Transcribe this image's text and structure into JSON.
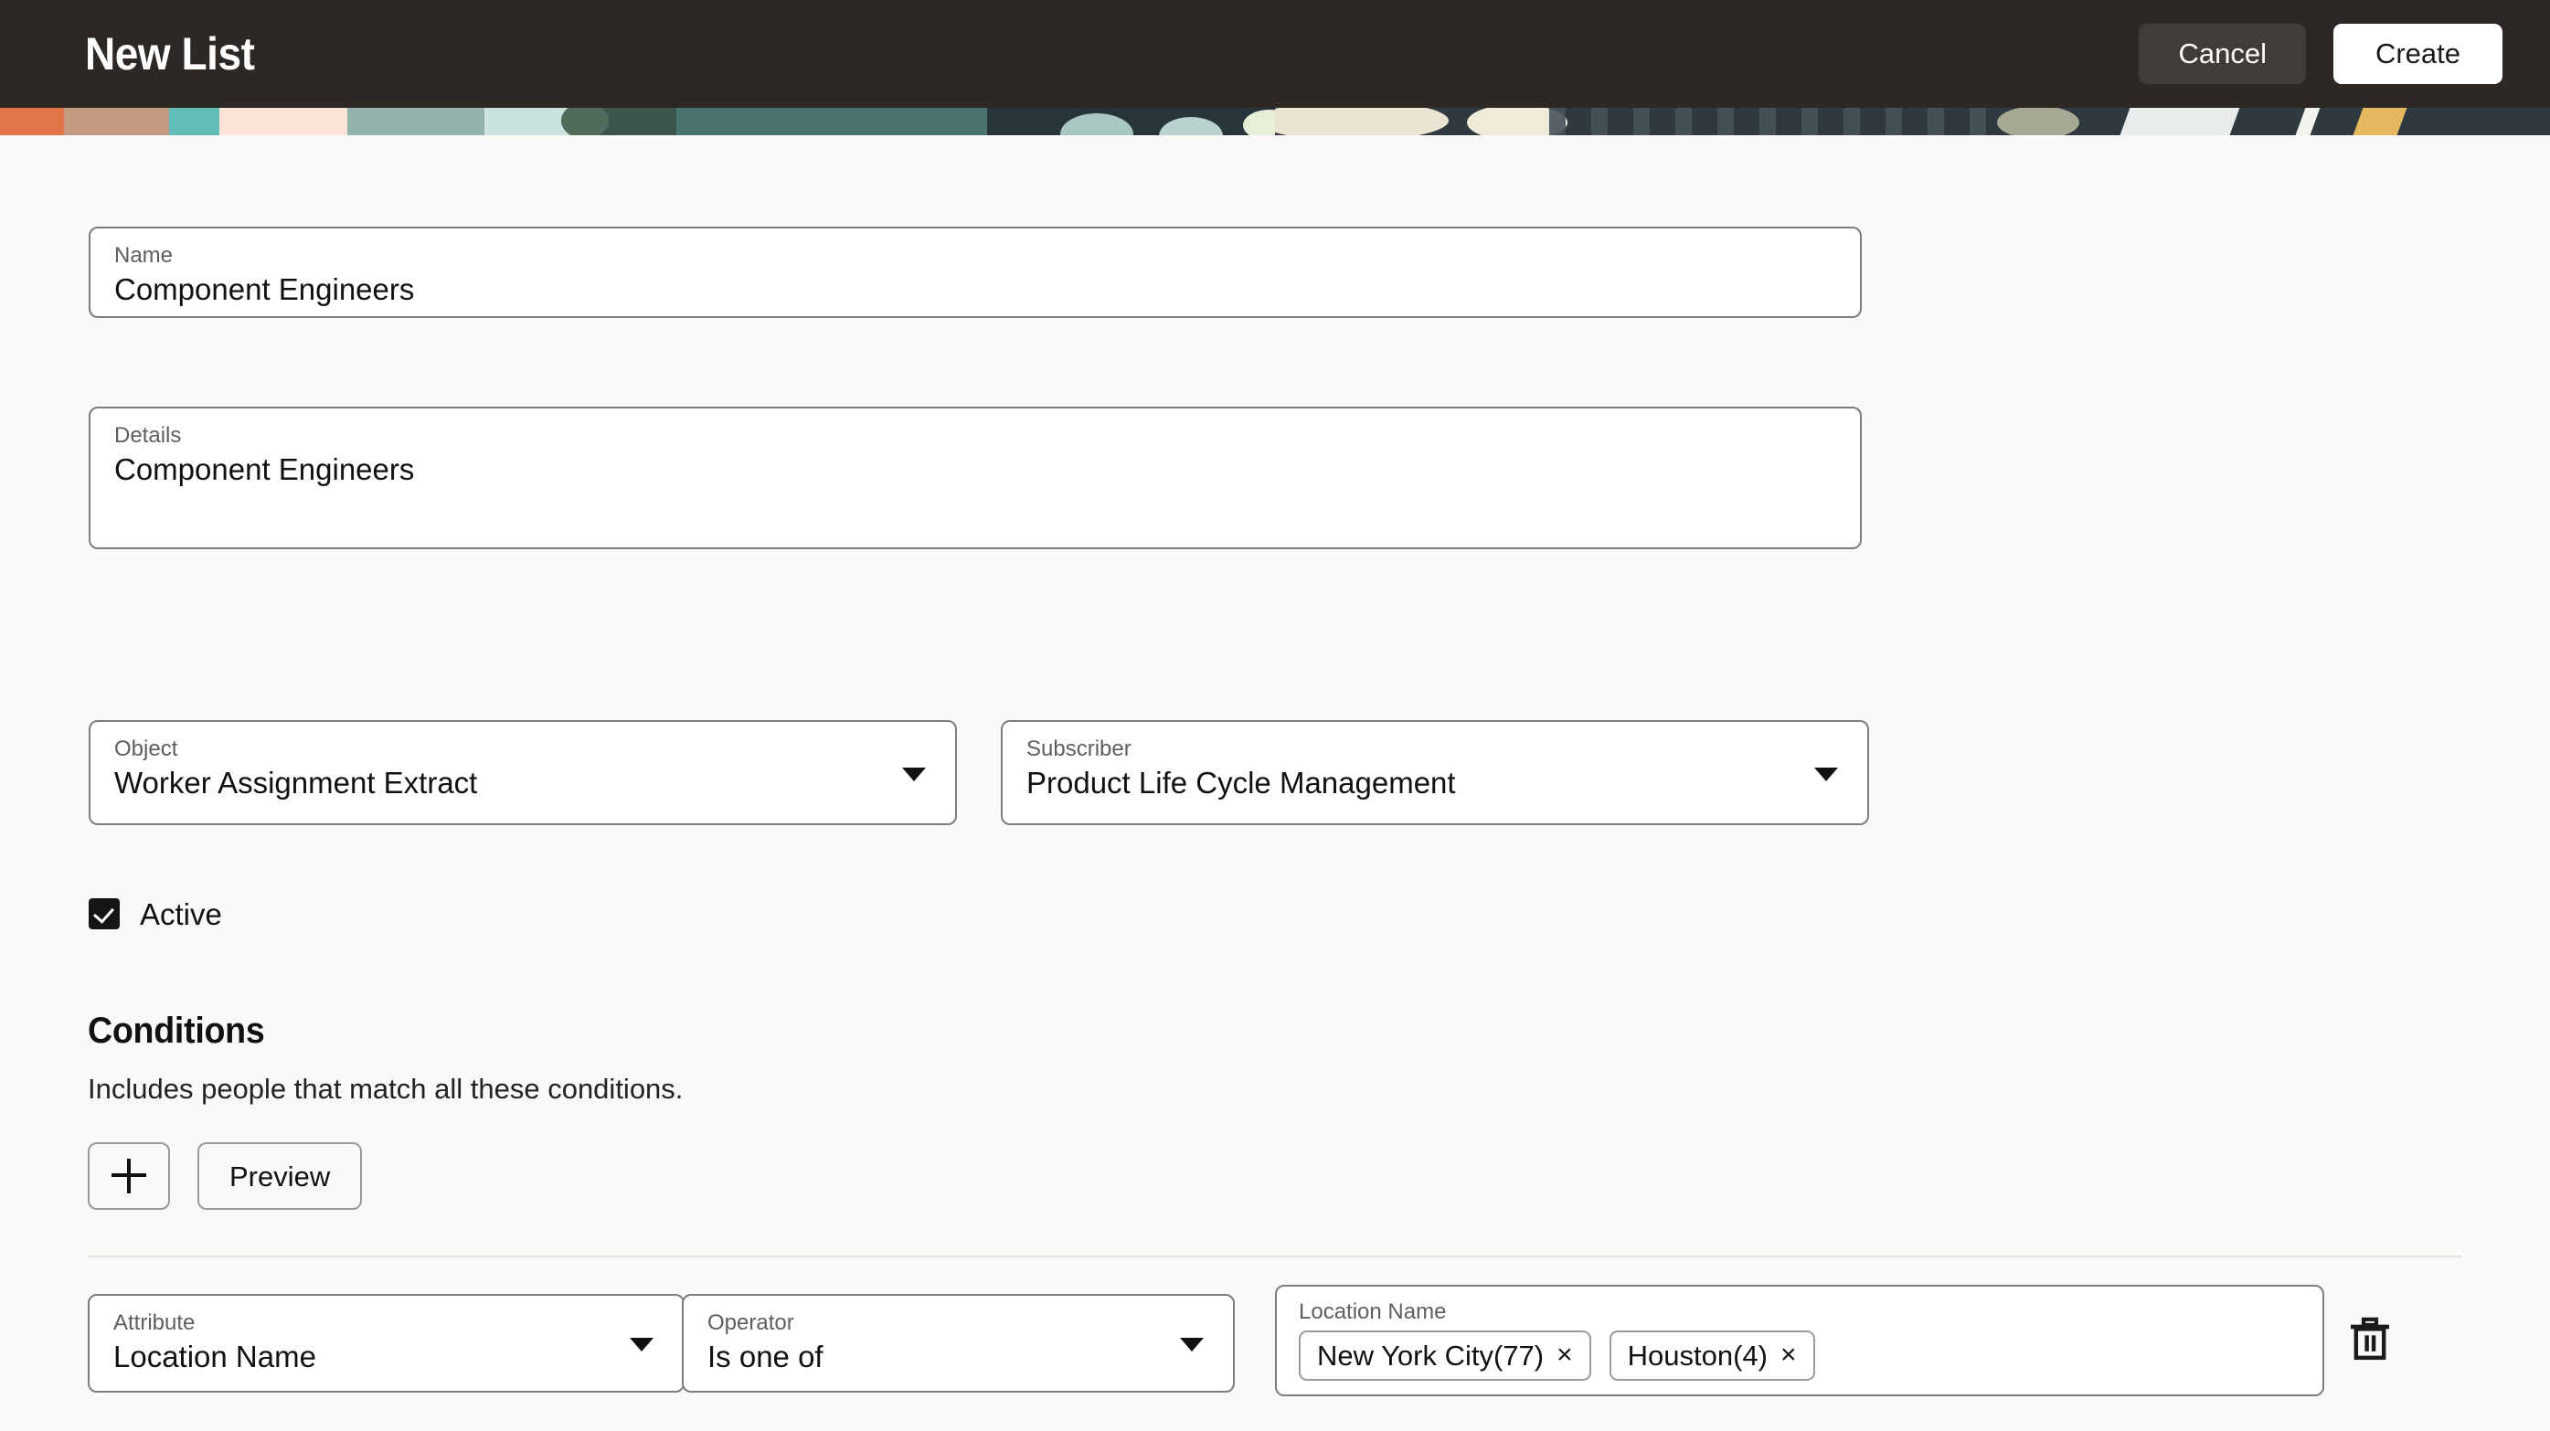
{
  "header": {
    "title": "New List",
    "cancel_label": "Cancel",
    "create_label": "Create"
  },
  "form": {
    "name": {
      "label": "Name",
      "value": "Component Engineers"
    },
    "details": {
      "label": "Details",
      "value": "Component Engineers"
    },
    "object": {
      "label": "Object",
      "value": "Worker Assignment Extract",
      "icon": "chevron-down-icon"
    },
    "subscriber": {
      "label": "Subscriber",
      "value": "Product Life Cycle Management",
      "icon": "chevron-down-icon"
    },
    "active": {
      "label": "Active",
      "checked": true
    }
  },
  "conditions": {
    "title": "Conditions",
    "description": "Includes people that match all these conditions.",
    "add_label": "+",
    "add_icon": "plus-icon",
    "preview_label": "Preview",
    "rows": [
      {
        "attribute": {
          "label": "Attribute",
          "value": "Location Name"
        },
        "operator": {
          "label": "Operator",
          "value": "Is one of"
        },
        "values": {
          "label": "Location Name",
          "chips": [
            {
              "text": "New York City(77)",
              "remove": "×"
            },
            {
              "text": "Houston(4)",
              "remove": "×"
            }
          ]
        },
        "delete_icon": "trash-icon"
      }
    ]
  },
  "colors": {
    "header_bg": "#2d2824",
    "cancel_bg": "#413c38",
    "create_bg": "#ffffff",
    "page_bg": "#faf9f7",
    "field_border": "#7d7d7d",
    "checkbox_fill": "#151515"
  }
}
